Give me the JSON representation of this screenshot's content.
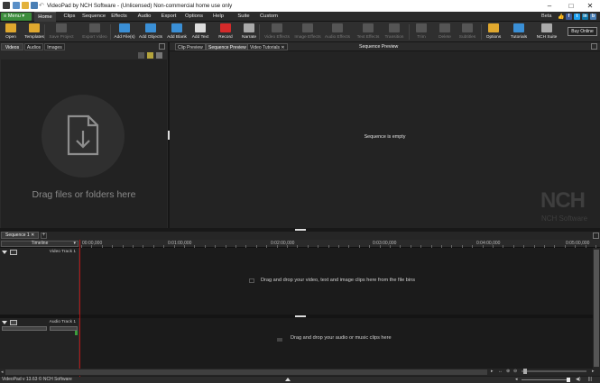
{
  "titlebar": {
    "title": "VideoPad by NCH Software - (Unlicensed) Non-commercial home use only",
    "minimize": "–",
    "maximize": "□",
    "close": "✕"
  },
  "menubar": {
    "menu_label": "Menu",
    "tabs": [
      "Home",
      "Clips",
      "Sequence",
      "Effects",
      "Audio",
      "Export",
      "Options",
      "Help",
      "Suite",
      "Custom"
    ],
    "active_tab": "Home",
    "beta": "Beta",
    "social": [
      "f",
      "t",
      "in",
      "b"
    ]
  },
  "ribbon": {
    "buttons": [
      {
        "label": "Open",
        "icon": "folder-open-icon",
        "enabled": true,
        "color": "#e0a82e"
      },
      {
        "label": "Templates",
        "icon": "templates-icon",
        "enabled": true,
        "color": "#e0a82e"
      },
      {
        "label": "Save Project",
        "icon": "save-icon",
        "enabled": false,
        "color": "#555555"
      },
      {
        "label": "Export Video",
        "icon": "export-video-icon",
        "enabled": false,
        "color": "#555555"
      },
      {
        "label": "Add File(s)",
        "icon": "add-files-icon",
        "enabled": true,
        "color": "#3a8fd6"
      },
      {
        "label": "Add Objects",
        "icon": "add-objects-icon",
        "enabled": true,
        "color": "#3a8fd6"
      },
      {
        "label": "Add Blank",
        "icon": "add-blank-icon",
        "enabled": true,
        "color": "#3a8fd6"
      },
      {
        "label": "Add Text",
        "icon": "add-text-icon",
        "enabled": true,
        "color": "#dddddd"
      },
      {
        "label": "Record",
        "icon": "record-icon",
        "enabled": true,
        "color": "#d42a2a"
      },
      {
        "label": "Narrate",
        "icon": "narrate-icon",
        "enabled": true,
        "color": "#aaaaaa"
      },
      {
        "label": "Video Effects",
        "icon": "video-effects-icon",
        "enabled": false,
        "color": "#555555"
      },
      {
        "label": "Image Effects",
        "icon": "image-effects-icon",
        "enabled": false,
        "color": "#555555"
      },
      {
        "label": "Audio Effects",
        "icon": "audio-effects-icon",
        "enabled": false,
        "color": "#555555"
      },
      {
        "label": "Text Effects",
        "icon": "text-effects-icon",
        "enabled": false,
        "color": "#555555"
      },
      {
        "label": "Transition",
        "icon": "transition-icon",
        "enabled": false,
        "color": "#555555"
      },
      {
        "label": "Trim",
        "icon": "trim-icon",
        "enabled": false,
        "color": "#555555"
      },
      {
        "label": "Delete",
        "icon": "delete-icon",
        "enabled": false,
        "color": "#555555"
      },
      {
        "label": "Subtitles",
        "icon": "subtitles-icon",
        "enabled": false,
        "color": "#555555"
      },
      {
        "label": "Options",
        "icon": "options-icon",
        "enabled": true,
        "color": "#e0a82e"
      },
      {
        "label": "Tutorials",
        "icon": "tutorials-icon",
        "enabled": true,
        "color": "#3a8fd6"
      },
      {
        "label": "NCH Suite",
        "icon": "nch-suite-icon",
        "enabled": true,
        "color": "#aaaaaa"
      }
    ],
    "buy_online": "Buy Online"
  },
  "media_panel": {
    "tabs": [
      "Videos",
      "Audios",
      "Images"
    ],
    "active_tab": "Videos",
    "drop_text": "Drag files or folders here"
  },
  "preview_panel": {
    "tabs": [
      "Clip Preview",
      "Sequence Preview",
      "Video Tutorials"
    ],
    "active_tab": "Sequence Preview",
    "title": "Sequence Preview",
    "empty_text": "Sequence is empty",
    "logo_text": "NCH",
    "logo_sub": "NCH Software"
  },
  "timeline": {
    "sequence_tab": "Sequence 1",
    "add_tab": "+",
    "timeline_label": "Timeline",
    "ticks": [
      "00:00,000",
      "0:01:00,000",
      "0:02:00,000",
      "0:03:00,000",
      "0:04:00,000",
      "0:05:00,000"
    ],
    "video_track": {
      "name": "Video Track 1",
      "hint": "Drag and drop your video, text and image clips here from the file bins"
    },
    "audio_track": {
      "name": "Audio Track 1",
      "hint": "Drag and drop your audio or music clips here"
    }
  },
  "statusbar": {
    "text": "VideoPad v 13.63 © NCH Software"
  }
}
